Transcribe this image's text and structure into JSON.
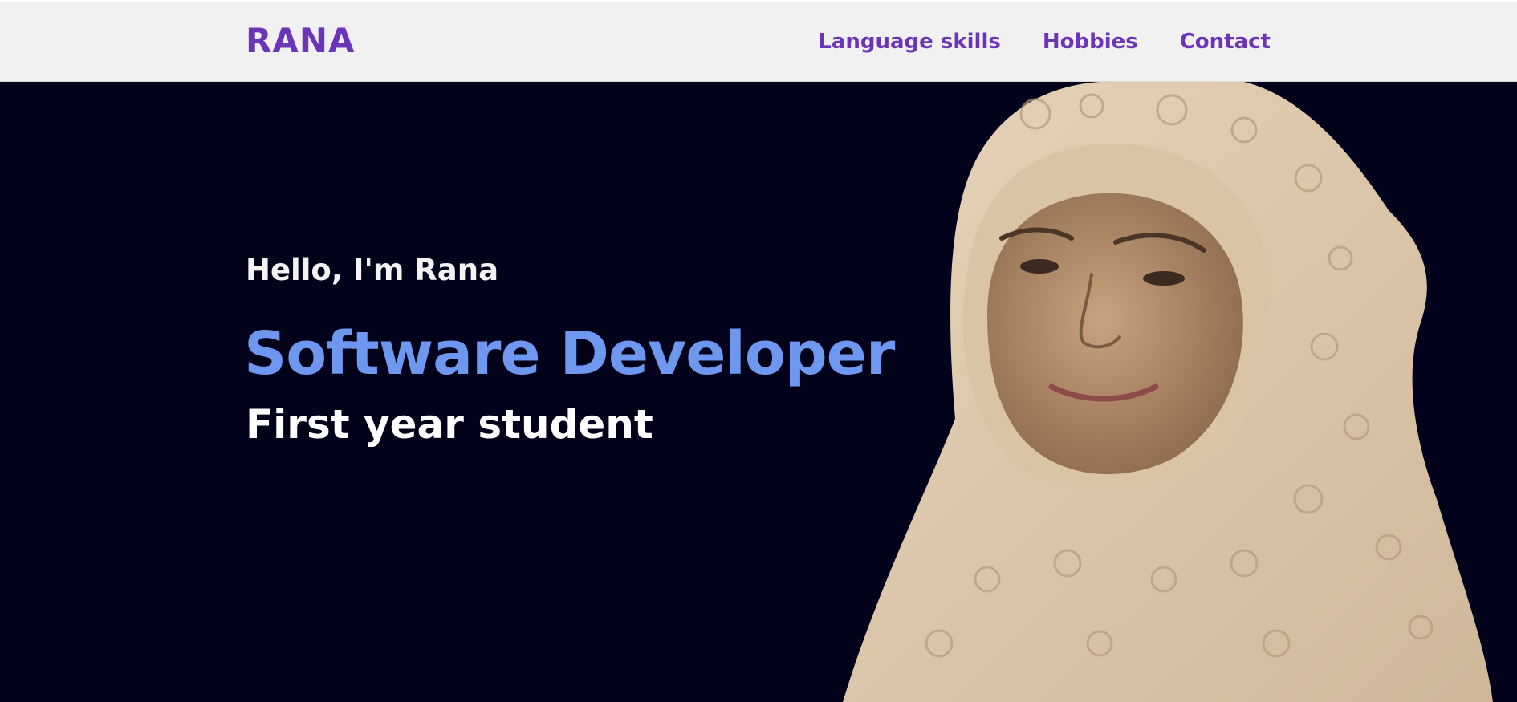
{
  "header": {
    "brand": "RANA",
    "nav": [
      {
        "label": "Language skills"
      },
      {
        "label": "Hobbies"
      },
      {
        "label": "Contact"
      }
    ]
  },
  "hero": {
    "greeting": "Hello, I'm Rana",
    "role": "Software Developer",
    "subtitle": "First year student"
  },
  "colors": {
    "brand": "#6a35b8",
    "hero_background": "#02021a",
    "accent": "#6e97ef",
    "navbar_background": "#f1f1f1"
  }
}
